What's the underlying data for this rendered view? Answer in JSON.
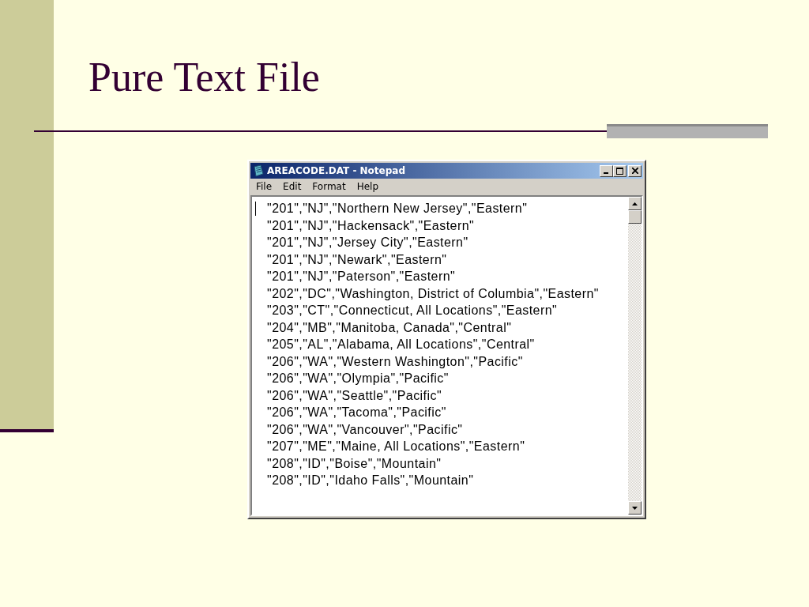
{
  "slide": {
    "title": "Pure Text File"
  },
  "window": {
    "title": "AREACODE.DAT - Notepad",
    "menu": [
      "File",
      "Edit",
      "Format",
      "Help"
    ],
    "lines": [
      "\"201\",\"NJ\",\"Northern New Jersey\",\"Eastern\"",
      "\"201\",\"NJ\",\"Hackensack\",\"Eastern\"",
      "\"201\",\"NJ\",\"Jersey City\",\"Eastern\"",
      "\"201\",\"NJ\",\"Newark\",\"Eastern\"",
      "\"201\",\"NJ\",\"Paterson\",\"Eastern\"",
      "\"202\",\"DC\",\"Washington, District of Columbia\",\"Eastern\"",
      "\"203\",\"CT\",\"Connecticut, All Locations\",\"Eastern\"",
      "\"204\",\"MB\",\"Manitoba, Canada\",\"Central\"",
      "\"205\",\"AL\",\"Alabama, All Locations\",\"Central\"",
      "\"206\",\"WA\",\"Western Washington\",\"Pacific\"",
      "\"206\",\"WA\",\"Olympia\",\"Pacific\"",
      "\"206\",\"WA\",\"Seattle\",\"Pacific\"",
      "\"206\",\"WA\",\"Tacoma\",\"Pacific\"",
      "\"206\",\"WA\",\"Vancouver\",\"Pacific\"",
      "\"207\",\"ME\",\"Maine, All Locations\",\"Eastern\"",
      "\"208\",\"ID\",\"Boise\",\"Mountain\"",
      "\"208\",\"ID\",\"Idaho Falls\",\"Mountain\""
    ]
  }
}
